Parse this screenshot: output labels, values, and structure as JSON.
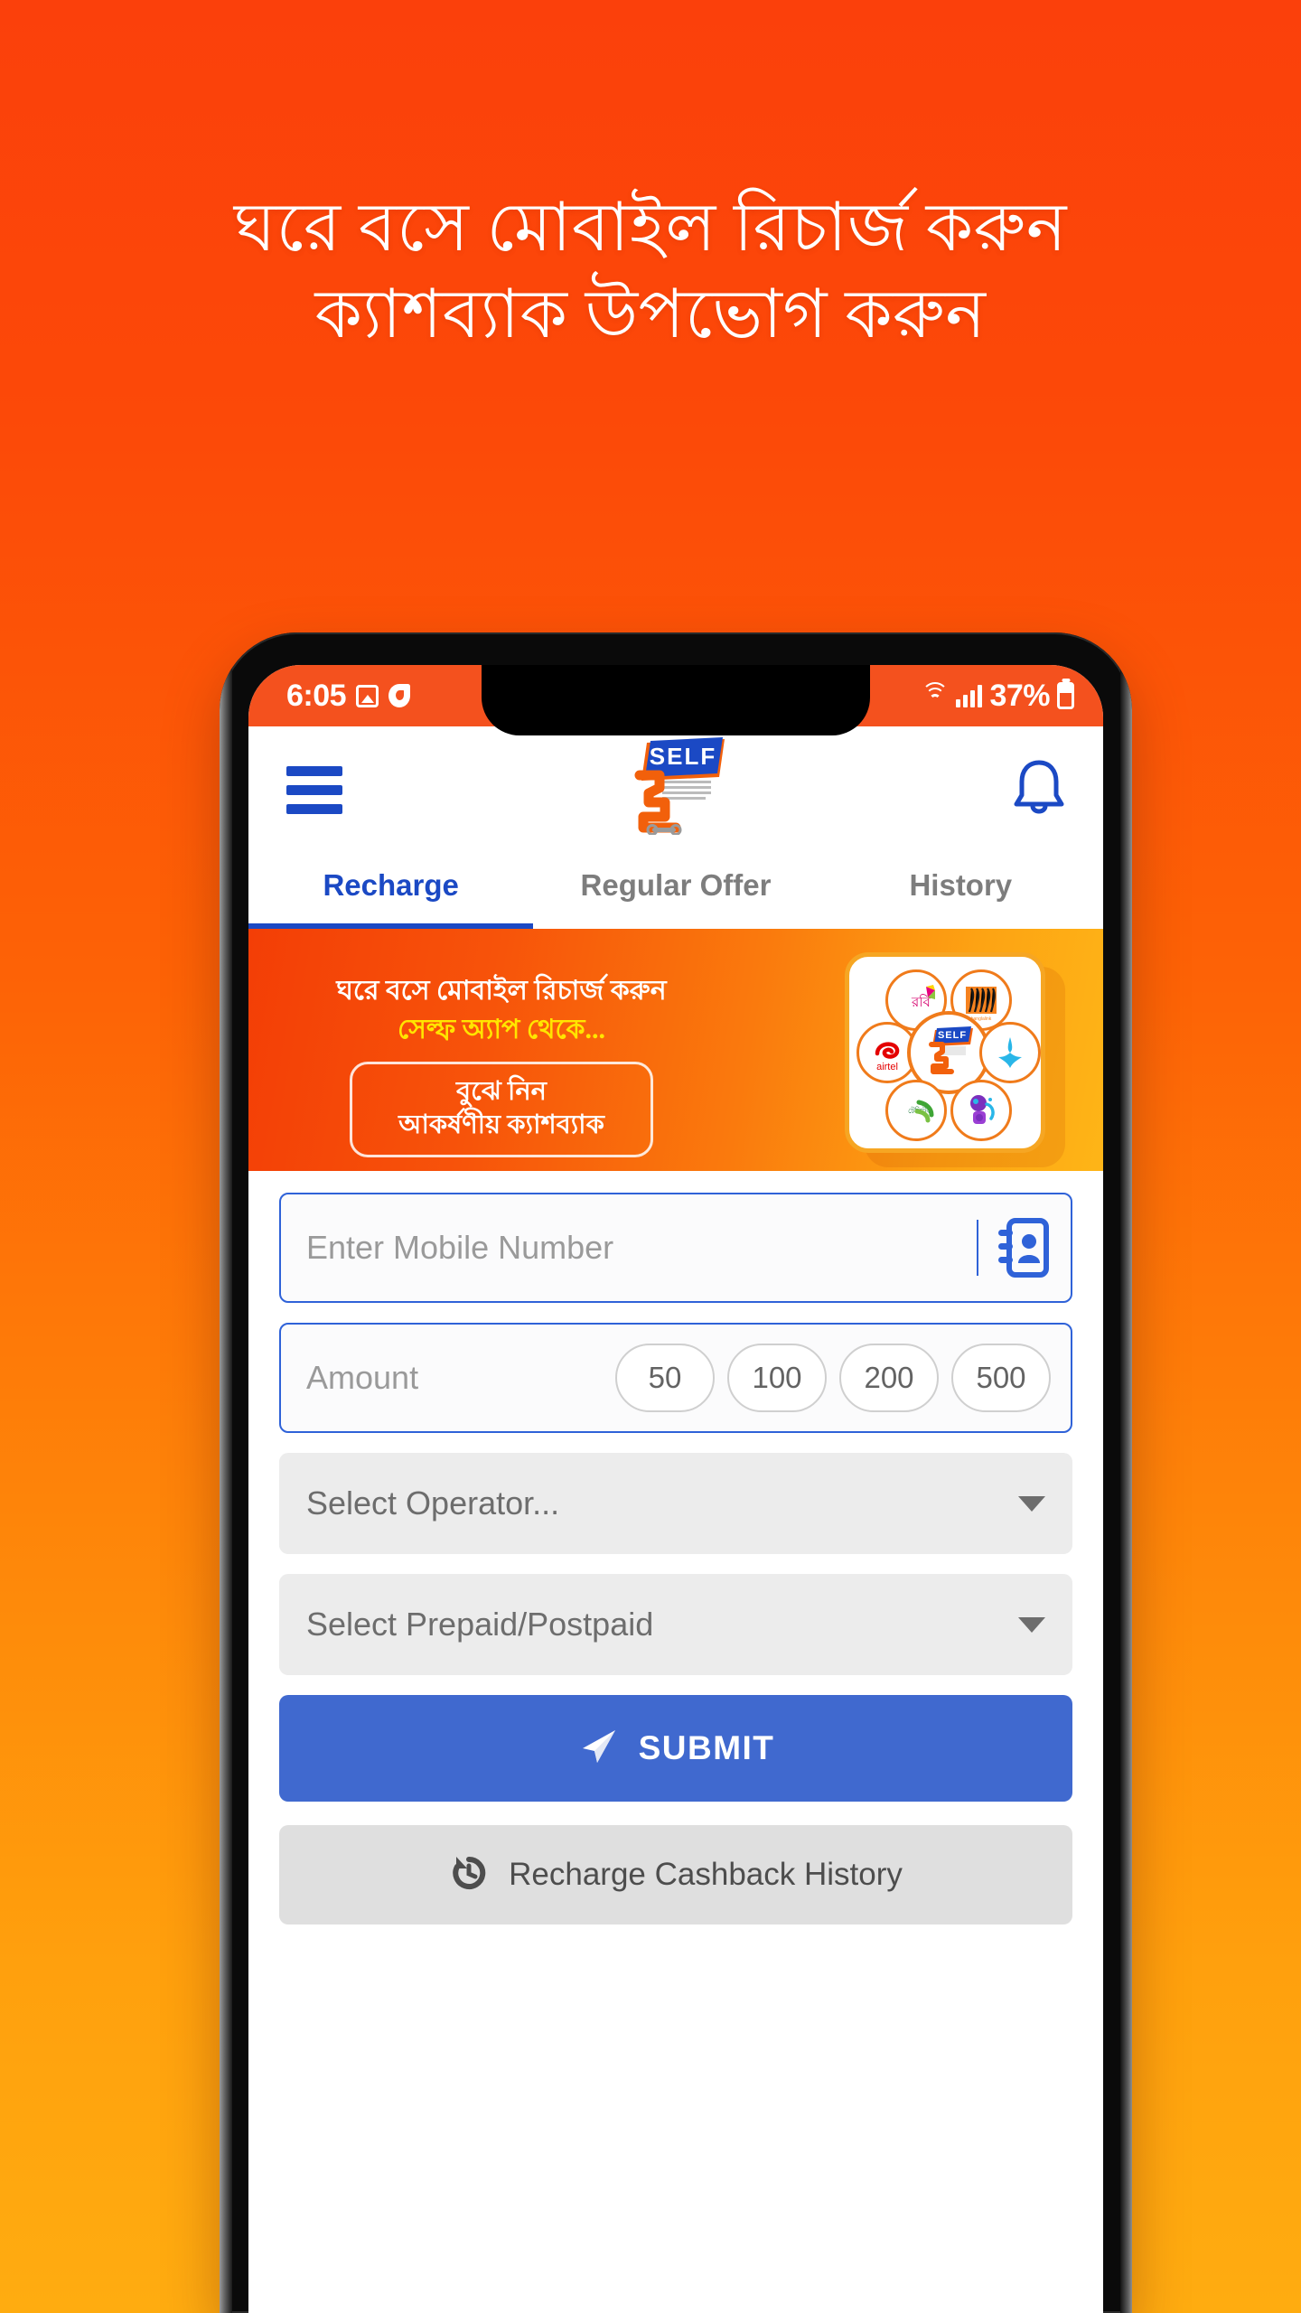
{
  "headline": {
    "line1": "ঘরে বসে মোবাইল রিচার্জ করুন",
    "line2": "ক্যাশব্যাক উপভোগ করুন"
  },
  "colors": {
    "bg_top": "#FB400B",
    "bg_bottom": "#FFAC10",
    "brand_blue": "#1B49C4",
    "submit_blue": "#4069CF",
    "status_orange": "#F4511E",
    "banner_yellow": "#FFE500"
  },
  "status_bar": {
    "time": "6:05",
    "battery_percent": "37%",
    "icons": [
      "photo-icon",
      "bixby-icon",
      "wifi-icon",
      "signal-bars-icon",
      "battery-icon"
    ]
  },
  "app_header": {
    "menu_icon": "hamburger-icon",
    "logo_text": "SELF",
    "notification_icon": "bell-icon"
  },
  "tabs": [
    {
      "label": "Recharge",
      "active": true
    },
    {
      "label": "Regular Offer",
      "active": false
    },
    {
      "label": "History",
      "active": false
    }
  ],
  "banner": {
    "line1": "ঘরে বসে মোবাইল রিচার্জ করুন",
    "line2": "সেল্ফ অ্যাপ থেকে...",
    "cta_line1": "বুঝে নিন",
    "cta_line2": "আকর্ষণীয় ক্যাশব্যাক",
    "operators": [
      "রবি",
      "banglalink",
      "airtel",
      "SELF",
      "grameenphone",
      "teletalk"
    ]
  },
  "form": {
    "mobile_placeholder": "Enter Mobile Number",
    "mobile_value": "",
    "contact_icon": "contact-book-icon",
    "amount_placeholder": "Amount",
    "amount_value": "",
    "amount_chips": [
      "50",
      "100",
      "200",
      "500"
    ],
    "operator_select": "Select Operator...",
    "prepaid_select": "Select Prepaid/Postpaid",
    "submit_label": "SUBMIT",
    "submit_icon": "send-icon",
    "history_label": "Recharge Cashback History",
    "history_icon": "history-rotate-icon"
  }
}
